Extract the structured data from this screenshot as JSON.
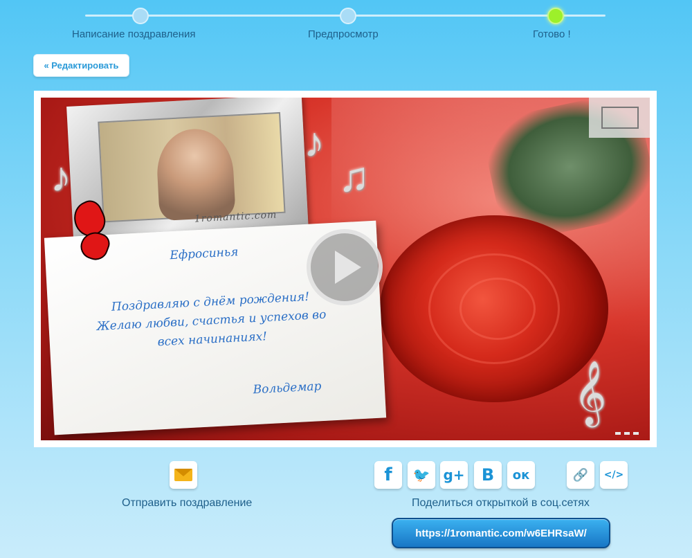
{
  "steps": [
    {
      "label": "Написание поздравления",
      "state": "done"
    },
    {
      "label": "Предпросмотр",
      "state": "done"
    },
    {
      "label": "Готово !",
      "state": "current"
    }
  ],
  "edit_button": {
    "label": "« Редактировать"
  },
  "card": {
    "brand": "1romantic.com",
    "recipient": "Ефросинья",
    "message": "Поздравляю с днём рождения! Желаю любви, счастья и успехов во всех начинаниях!",
    "sender": "Вольдемар",
    "icons": {
      "play": "play-icon",
      "fullscreen": "fullscreen-icon",
      "more": "more-icon"
    }
  },
  "actions": {
    "send_label": "Отправить поздравление",
    "send_icon": "envelope-icon",
    "share_label": "Поделиться открыткой в соц.сетях",
    "social": [
      {
        "name": "facebook",
        "glyph": "f"
      },
      {
        "name": "twitter",
        "glyph": "🐦"
      },
      {
        "name": "google-plus",
        "glyph": "g+"
      },
      {
        "name": "vkontakte",
        "glyph": "B"
      },
      {
        "name": "odnoklassniki",
        "glyph": "ок"
      },
      {
        "name": "link",
        "glyph": "🔗"
      },
      {
        "name": "embed",
        "glyph": "</>"
      }
    ],
    "url": "https://1romantic.com/w6EHRsaW/"
  },
  "colors": {
    "accent": "#2a9ad8",
    "progress_current": "#9df02a",
    "url_button": "#1876c5"
  }
}
